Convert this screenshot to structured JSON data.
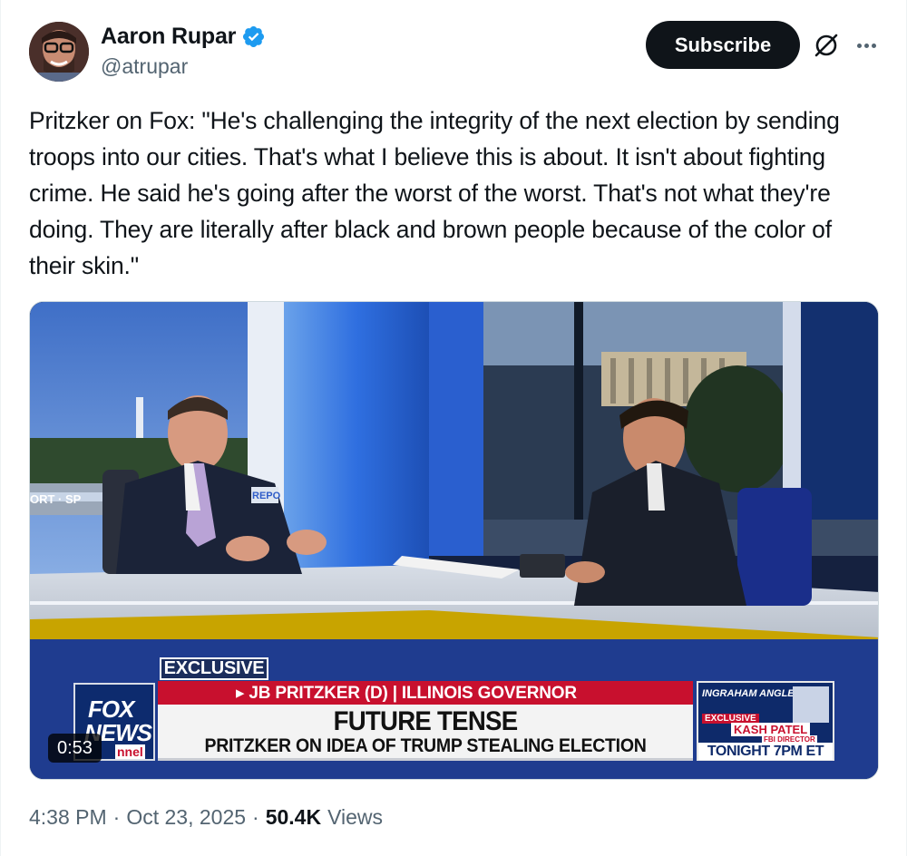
{
  "author": {
    "display_name": "Aaron Rupar",
    "handle": "@atrupar",
    "verified": true,
    "avatar_icon": "profile-photo"
  },
  "actions": {
    "subscribe_label": "Subscribe",
    "grok_icon": "grok-icon",
    "more_icon": "more-options-icon"
  },
  "tweet": {
    "text": "Pritzker on Fox: \"He's challenging the integrity of the next election by sending troops into our cities. That's what I believe this is about. It isn't about fighting crime. He said he's going after the worst of the worst. That's not what they're doing. They are literally after black and brown people because of the color of their skin.\""
  },
  "media": {
    "type": "video",
    "duration": "0:53",
    "chyron": {
      "tag": "EXCLUSIVE",
      "network_line1": "FOX",
      "network_line2": "NEWS",
      "network_line3": "nnel",
      "name_line": "▸ JB PRITZKER (D) | ILLINOIS GOVERNOR",
      "headline": "FUTURE TENSE",
      "subhead": "PRITZKER ON IDEA OF TRUMP STEALING ELECTION",
      "promo_show": "INGRAHAM ANGLE",
      "promo_tag": "EXCLUSIVE",
      "promo_guest": "KASH PATEL",
      "promo_role": "FBI DIRECTOR",
      "promo_time": "TONIGHT 7PM ET"
    }
  },
  "footer": {
    "time": "4:38 PM",
    "sep1": "·",
    "date": "Oct 23, 2025",
    "sep2": "·",
    "views_count": "50.4K",
    "views_label": "Views"
  },
  "colors": {
    "text_primary": "#0f1419",
    "text_secondary": "#536471",
    "verified_blue": "#1d9bf0",
    "button_dark": "#0f1419",
    "fox_red": "#c8102e",
    "fox_navy": "#0e2a6a"
  }
}
